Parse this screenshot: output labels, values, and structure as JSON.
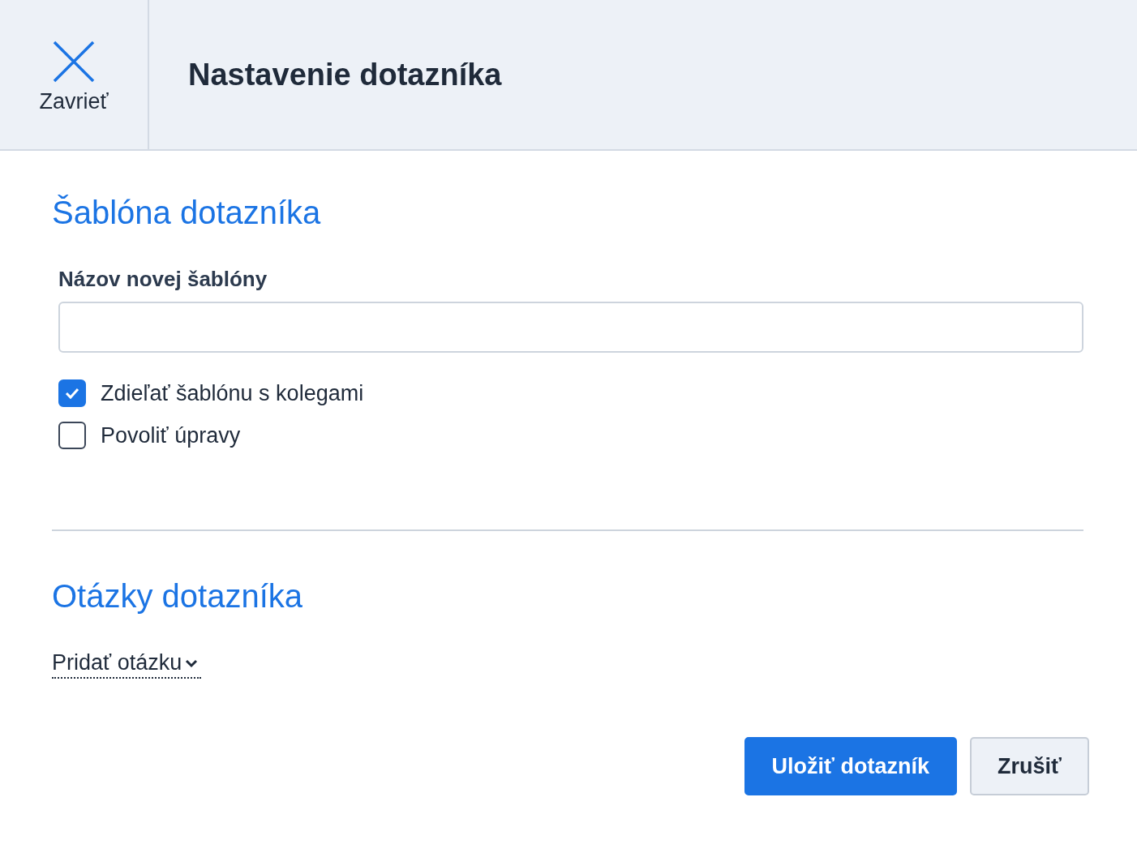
{
  "header": {
    "close_label": "Zavrieť",
    "title": "Nastavenie dotazníka"
  },
  "template_section": {
    "heading": "Šablóna dotazníka",
    "name_label": "Názov novej šablóny",
    "options": [
      {
        "label": "Zdieľať šablónu s kolegami",
        "checked": true
      },
      {
        "label": "Povoliť úpravy",
        "checked": false
      }
    ]
  },
  "questions_section": {
    "heading": "Otázky dotazníka",
    "add_question": "Pridať otázku"
  },
  "buttons": [
    {
      "label": "Uložiť dotazník",
      "kind": "primary"
    },
    {
      "label": "Zrušiť",
      "kind": "secondary"
    }
  ]
}
